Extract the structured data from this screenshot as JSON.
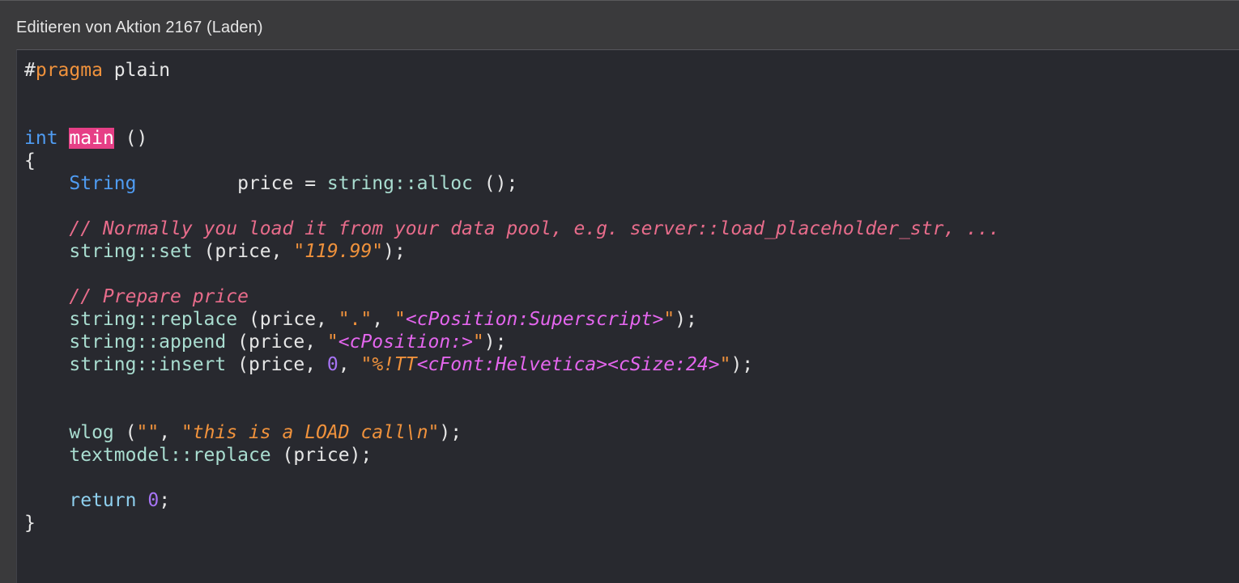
{
  "window": {
    "title": "Editieren von Aktion 2167 (Laden)"
  },
  "colors": {
    "background": "#3a3a3c",
    "editor_background": "#28292f",
    "keyword": "#4f9cf3",
    "function": "#a9ddd0",
    "comment": "#e86c8b",
    "string": "#f0923c",
    "tag": "#e466ee",
    "number": "#a774f5",
    "highlight": "#e63f86"
  },
  "code": {
    "lines": [
      [
        {
          "t": "#",
          "c": "hash"
        },
        {
          "t": "pragma",
          "c": "dir"
        },
        {
          "t": " plain",
          "c": "plain"
        }
      ],
      [],
      [],
      [
        {
          "t": "int",
          "c": "kw"
        },
        {
          "t": " ",
          "c": "plain"
        },
        {
          "t": "main",
          "c": "hl"
        },
        {
          "t": " ()",
          "c": "plain"
        }
      ],
      [
        {
          "t": "{",
          "c": "plain"
        }
      ],
      [
        {
          "t": "    ",
          "c": "plain"
        },
        {
          "t": "String",
          "c": "kw"
        },
        {
          "t": "         price = ",
          "c": "id"
        },
        {
          "t": "string::alloc",
          "c": "fn"
        },
        {
          "t": " ();",
          "c": "plain"
        }
      ],
      [],
      [
        {
          "t": "    ",
          "c": "plain"
        },
        {
          "t": "// Normally you load it from your data pool, e.g. server::load_placeholder_str, ...",
          "c": "cm"
        }
      ],
      [
        {
          "t": "    ",
          "c": "plain"
        },
        {
          "t": "string::set",
          "c": "fn"
        },
        {
          "t": " (price, ",
          "c": "id"
        },
        {
          "t": "\"",
          "c": "q"
        },
        {
          "t": "119.99",
          "c": "str"
        },
        {
          "t": "\"",
          "c": "q"
        },
        {
          "t": ");",
          "c": "plain"
        }
      ],
      [],
      [
        {
          "t": "    ",
          "c": "plain"
        },
        {
          "t": "// Prepare price",
          "c": "cm"
        }
      ],
      [
        {
          "t": "    ",
          "c": "plain"
        },
        {
          "t": "string::replace",
          "c": "fn"
        },
        {
          "t": " (price, ",
          "c": "id"
        },
        {
          "t": "\".\"",
          "c": "q"
        },
        {
          "t": ", ",
          "c": "plain"
        },
        {
          "t": "\"",
          "c": "q"
        },
        {
          "t": "<cPosition:Superscript>",
          "c": "tag"
        },
        {
          "t": "\"",
          "c": "q"
        },
        {
          "t": ");",
          "c": "plain"
        }
      ],
      [
        {
          "t": "    ",
          "c": "plain"
        },
        {
          "t": "string::append",
          "c": "fn"
        },
        {
          "t": " (price, ",
          "c": "id"
        },
        {
          "t": "\"",
          "c": "q"
        },
        {
          "t": "<cPosition:>",
          "c": "tag"
        },
        {
          "t": "\"",
          "c": "q"
        },
        {
          "t": ");",
          "c": "plain"
        }
      ],
      [
        {
          "t": "    ",
          "c": "plain"
        },
        {
          "t": "string::insert",
          "c": "fn"
        },
        {
          "t": " (price, ",
          "c": "id"
        },
        {
          "t": "0",
          "c": "num"
        },
        {
          "t": ", ",
          "c": "plain"
        },
        {
          "t": "\"",
          "c": "q"
        },
        {
          "t": "%!TT",
          "c": "str"
        },
        {
          "t": "<cFont:Helvetica><cSize:24>",
          "c": "tag"
        },
        {
          "t": "\"",
          "c": "q"
        },
        {
          "t": ");",
          "c": "plain"
        }
      ],
      [],
      [],
      [
        {
          "t": "    ",
          "c": "plain"
        },
        {
          "t": "wlog",
          "c": "fn"
        },
        {
          "t": " (",
          "c": "plain"
        },
        {
          "t": "\"\"",
          "c": "q"
        },
        {
          "t": ", ",
          "c": "plain"
        },
        {
          "t": "\"",
          "c": "q"
        },
        {
          "t": "this is a LOAD call\\n",
          "c": "str"
        },
        {
          "t": "\"",
          "c": "q"
        },
        {
          "t": ");",
          "c": "plain"
        }
      ],
      [
        {
          "t": "    ",
          "c": "plain"
        },
        {
          "t": "textmodel::replace",
          "c": "fn"
        },
        {
          "t": " (price);",
          "c": "id"
        }
      ],
      [],
      [
        {
          "t": "    ",
          "c": "plain"
        },
        {
          "t": "return",
          "c": "ret"
        },
        {
          "t": " ",
          "c": "plain"
        },
        {
          "t": "0",
          "c": "num"
        },
        {
          "t": ";",
          "c": "plain"
        }
      ],
      [
        {
          "t": "}",
          "c": "plain"
        }
      ]
    ]
  }
}
